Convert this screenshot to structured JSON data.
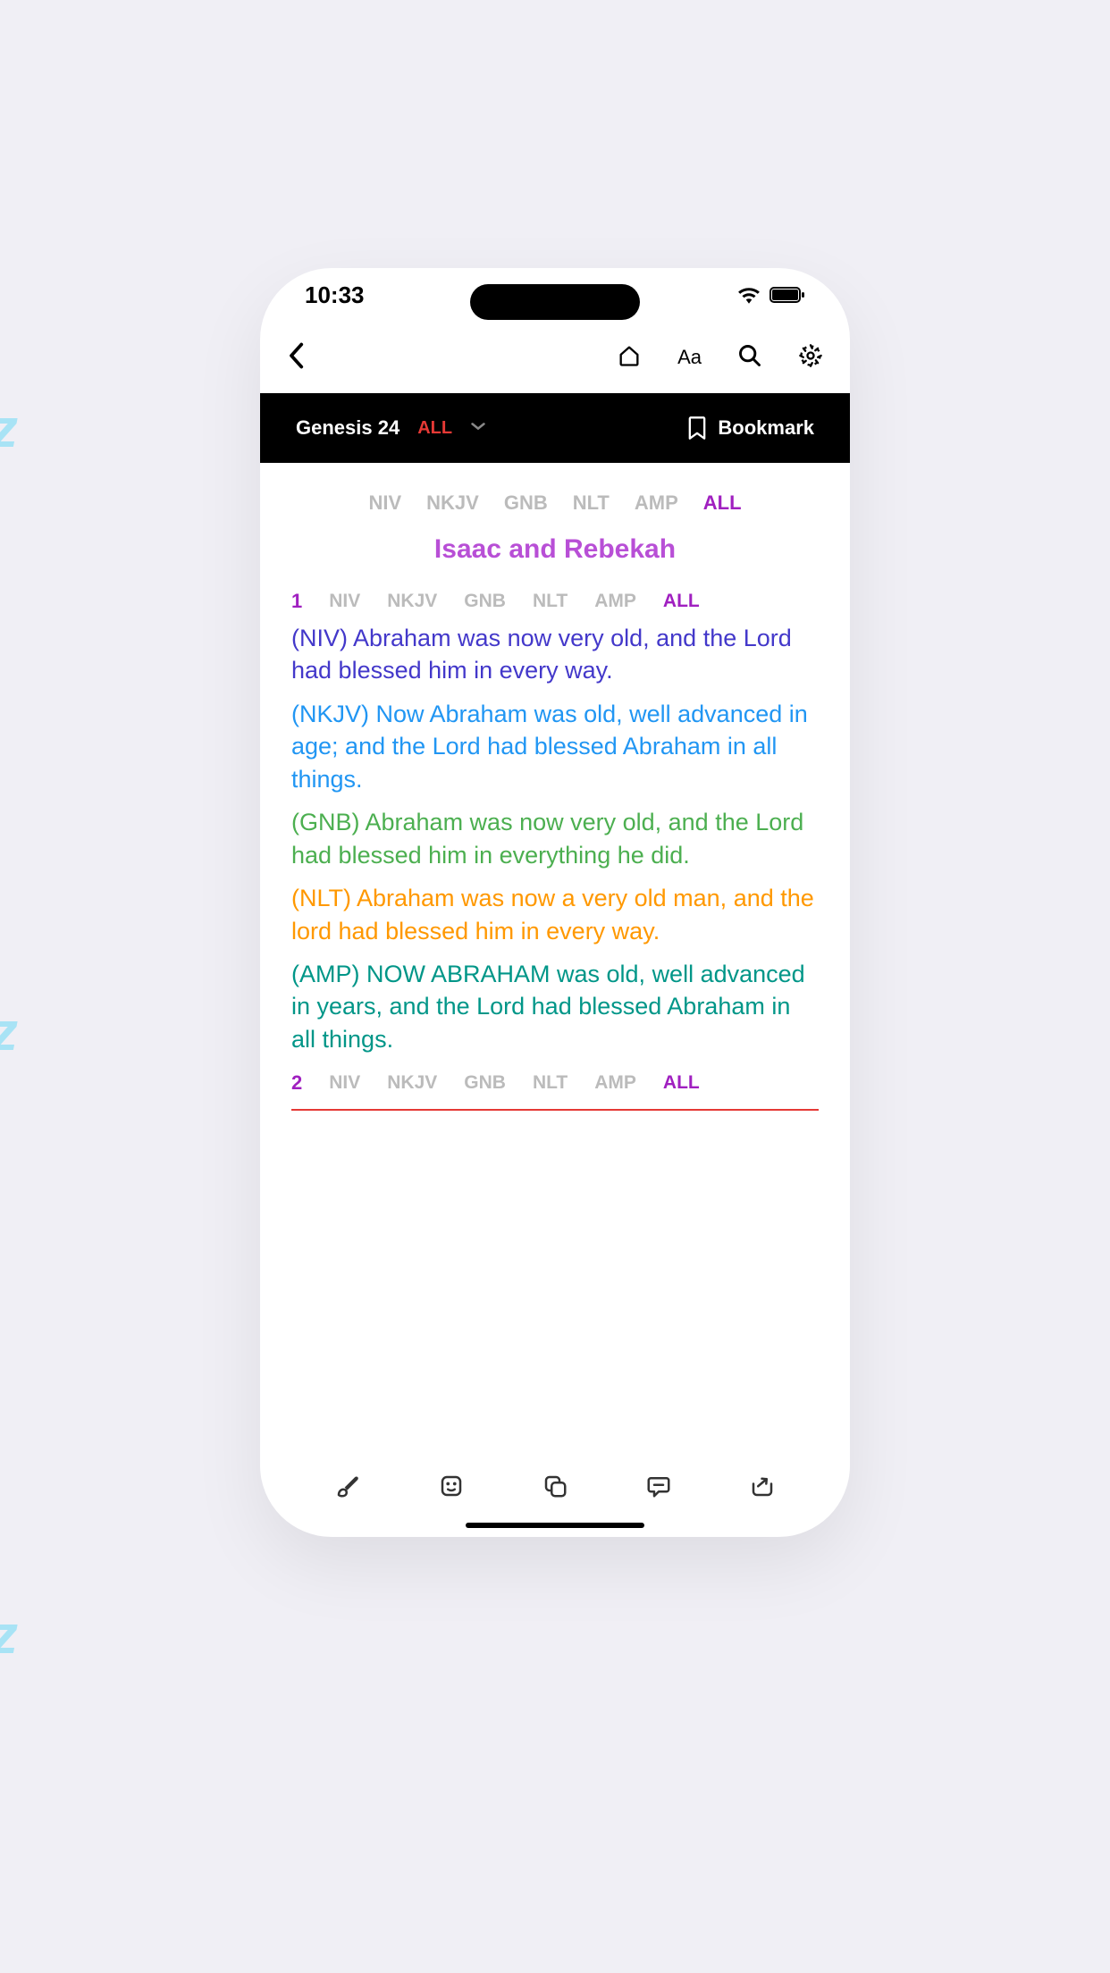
{
  "status": {
    "time": "10:33"
  },
  "chapter": {
    "title": "Genesis 24",
    "version": "ALL",
    "bookmark_label": "Bookmark"
  },
  "versions": [
    "NIV",
    "NKJV",
    "GNB",
    "NLT",
    "AMP",
    "ALL"
  ],
  "active_version": "ALL",
  "section_title": "Isaac and Rebekah",
  "verses": [
    {
      "num": "1",
      "translations": [
        {
          "key": "NIV",
          "text": "(NIV) Abraham was now very old, and the Lord had blessed him in every way."
        },
        {
          "key": "NKJV",
          "text": "(NKJV) Now Abraham was old, well advanced in age; and the Lord had blessed Abraham in all things."
        },
        {
          "key": "GNB",
          "text": "(GNB) Abraham was now very old, and the Lord had blessed him in everything he did."
        },
        {
          "key": "NLT",
          "text": "(NLT) Abraham was now a very old man, and the lord had blessed him in every way."
        },
        {
          "key": "AMP",
          "text": "(AMP) NOW ABRAHAM was old, well advanced in years, and the Lord had blessed Abraham in all things."
        }
      ]
    },
    {
      "num": "2",
      "translations": []
    }
  ]
}
